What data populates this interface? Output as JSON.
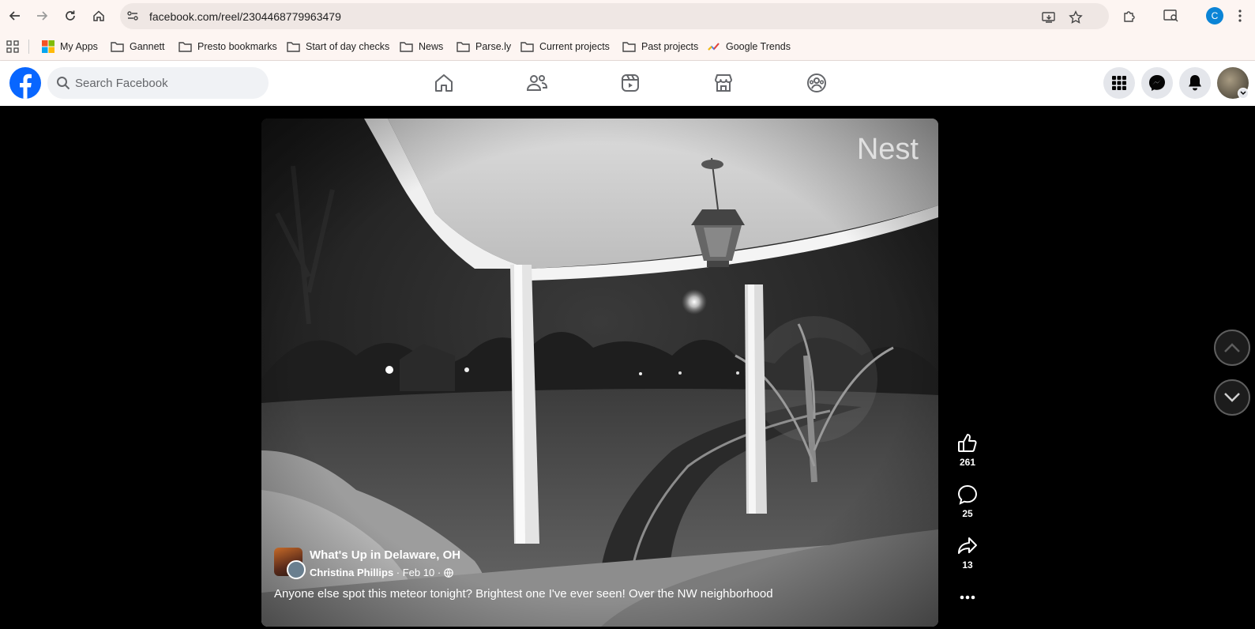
{
  "browser": {
    "url": "facebook.com/reel/2304468779963479",
    "bookmarks": [
      {
        "label": "My Apps",
        "icon": "microsoft-apps-icon"
      },
      {
        "label": "Gannett",
        "icon": "folder-icon"
      },
      {
        "label": "Presto bookmarks",
        "icon": "folder-icon"
      },
      {
        "label": "Start of day checks",
        "icon": "folder-icon"
      },
      {
        "label": "News",
        "icon": "folder-icon"
      },
      {
        "label": "Parse.ly",
        "icon": "folder-icon"
      },
      {
        "label": "Current projects",
        "icon": "folder-icon"
      },
      {
        "label": "Past projects",
        "icon": "folder-icon"
      },
      {
        "label": "Google Trends",
        "icon": "google-trends-icon"
      }
    ],
    "profile_initial": "C"
  },
  "facebook": {
    "search_placeholder": "Search Facebook",
    "brand_color": "#0866ff"
  },
  "reel": {
    "watermark": "Nest",
    "page_name": "What's Up in Delaware, OH",
    "author": "Christina Phillips",
    "date": " · Feb 10 · ",
    "caption": "Anyone else spot this meteor tonight? Brightest one I've ever seen! Over the NW neighborhood",
    "likes": "261",
    "comments": "25",
    "shares": "13"
  }
}
